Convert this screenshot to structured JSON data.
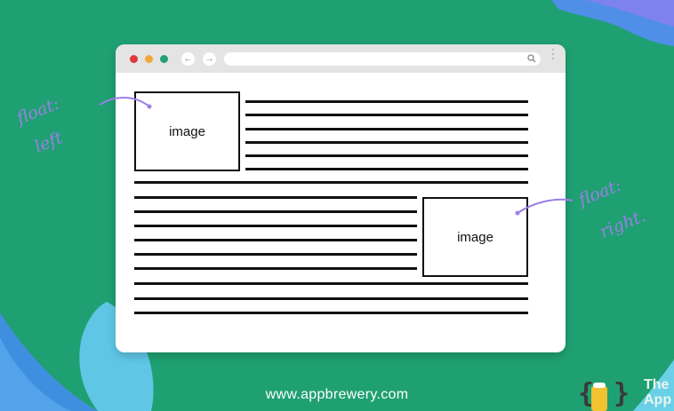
{
  "browser": {
    "nav": {
      "back_glyph": "←",
      "forward_glyph": "→",
      "menu_glyph": "⋮"
    },
    "traffic_light_colors": [
      "#e0383e",
      "#f2a93b",
      "#1fa072"
    ],
    "icons": [
      "search-icon",
      "arrow-left-icon",
      "arrow-right-icon",
      "kebab-menu-icon"
    ]
  },
  "content": {
    "image_left_label": "image",
    "image_right_label": "image"
  },
  "annotations": {
    "left_note": [
      "float:",
      "left"
    ],
    "right_note": [
      "float:",
      "right."
    ],
    "color": "#9b7fe6"
  },
  "footer": {
    "url": "www.appbrewery.com"
  },
  "brand": {
    "line1": "The",
    "line2": "App",
    "logo_colors": [
      "#f2c230",
      "#3a3a3a"
    ]
  },
  "colors": {
    "background": "#1fa072",
    "accent_shape": "#5fc6e6"
  }
}
